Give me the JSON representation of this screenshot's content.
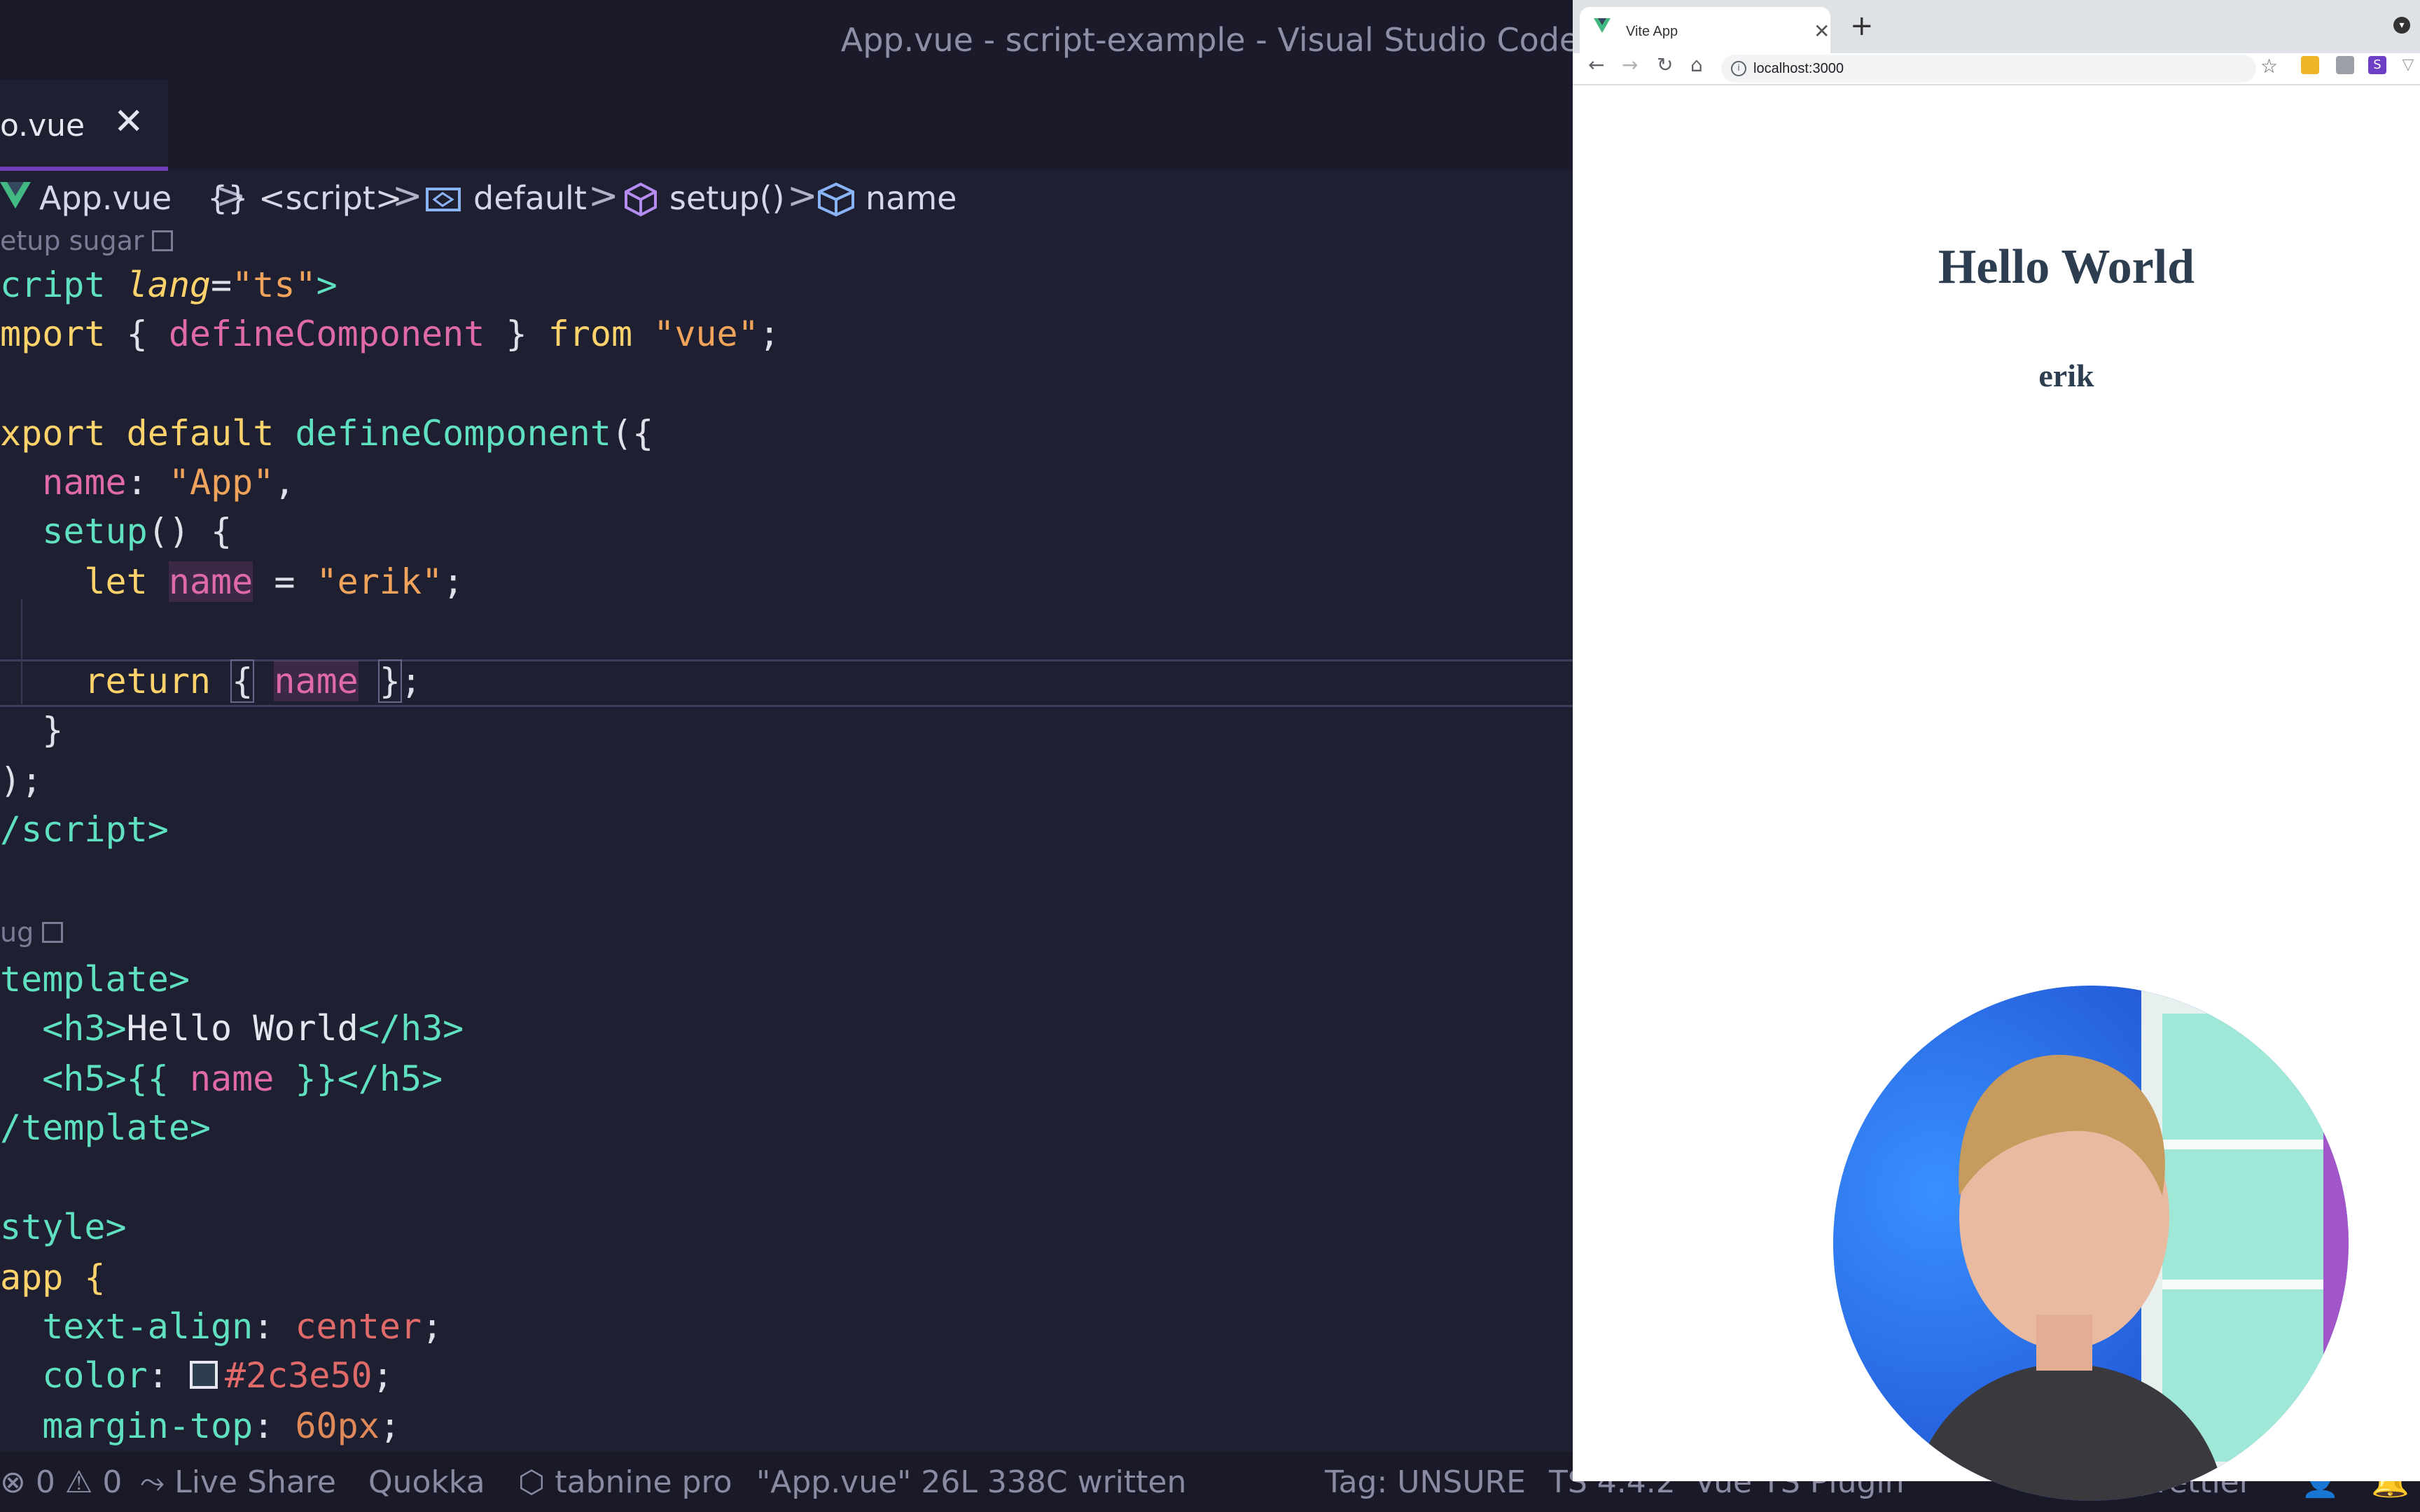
{
  "window": {
    "title": "App.vue - script-example - Visual Studio Code"
  },
  "editor": {
    "tab": {
      "label": "o.vue",
      "close": "✕"
    },
    "breadcrumb": {
      "file": "App.vue",
      "items": [
        "{} <script>",
        "default",
        "setup()",
        "name"
      ],
      "separator": ">"
    },
    "codelens": {
      "top": "etup sugar",
      "bottom": "ug"
    },
    "lines": [
      {
        "a": "cript ",
        "b": "lang",
        "c": "=",
        "d": "\"ts\"",
        "e": ">"
      },
      {
        "a": "mport",
        "b": " { ",
        "c": "defineComponent",
        "d": " } ",
        "e": "from",
        "f": " ",
        "g": "\"vue\"",
        "h": ";"
      },
      {
        "a": "xport default ",
        "b": "defineComponent",
        "c": "({"
      },
      {
        "a": "  ",
        "b": "name",
        "c": ": ",
        "d": "\"App\"",
        "e": ","
      },
      {
        "a": "  ",
        "b": "setup",
        "c": "() {"
      },
      {
        "a": "    ",
        "b": "let",
        "c": " ",
        "d": "name",
        "e": " = ",
        "f": "\"erik\"",
        "g": ";"
      },
      {
        "a": "    ",
        "b": "return",
        "c": " ",
        "d": "{",
        "e": " ",
        "f": "name",
        "g": " ",
        "h": "}",
        "i": ";"
      },
      {
        "a": "  }"
      },
      {
        "a": ");"
      },
      {
        "a": "/script>"
      },
      {
        "a": "template>"
      },
      {
        "a": "  <h3>",
        "b": "Hello World",
        "c": "</h3>"
      },
      {
        "a": "  <h5>",
        "b": "{{",
        "c": " ",
        "d": "name",
        "e": " ",
        "f": "}}",
        "g": "</h5>"
      },
      {
        "a": "/template>"
      },
      {
        "a": "style>"
      },
      {
        "a": "app {"
      },
      {
        "a": "  text-align",
        "b": ": ",
        "c": "center",
        "d": ";"
      },
      {
        "a": "  color",
        "b": ": ",
        "c": "#2c3e50",
        "d": ";"
      },
      {
        "a": "  margin-top",
        "b": ": ",
        "c": "60px",
        "d": ";"
      }
    ],
    "status": {
      "errors": "0",
      "warnings": "0",
      "live_share": "Live Share",
      "quokka": "Quokka",
      "tabnine": "tabnine pro",
      "message": "\"App.vue\" 26L 338C written",
      "tag": "Tag: UNSURE",
      "ts": "TS 4.4.2",
      "vue_plugin": "Vue TS Plugin",
      "prettier": "Prettier"
    }
  },
  "browser": {
    "tab_title": "Vite App",
    "tab_close": "✕",
    "new_tab": "+",
    "url": "localhost:3000",
    "page": {
      "heading": "Hello World",
      "subheading": "erik"
    }
  },
  "colors": {
    "accent": "#6e3fb8",
    "vue_green": "#42b883",
    "text_dark": "#2c3e50"
  }
}
